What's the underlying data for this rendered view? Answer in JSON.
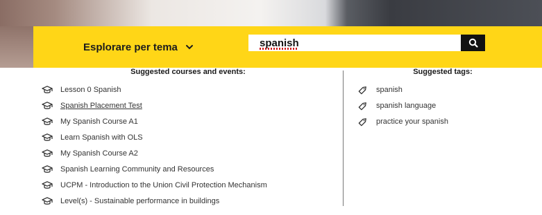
{
  "header": {
    "explore_label": "Esplorare per tema"
  },
  "search": {
    "value": "spanish"
  },
  "suggestions": {
    "courses_title": "Suggested courses and events:",
    "courses": [
      {
        "label": "Lesson 0 Spanish"
      },
      {
        "label": "Spanish Placement Test"
      },
      {
        "label": "My Spanish Course A1"
      },
      {
        "label": "Learn Spanish with OLS"
      },
      {
        "label": "My Spanish Course A2"
      },
      {
        "label": "Spanish Learning Community and Resources"
      },
      {
        "label": "UCPM - Introduction to the Union Civil Protection Mechanism"
      },
      {
        "label": "Level(s) - Sustainable performance in buildings"
      }
    ],
    "tags_title": "Suggested tags:",
    "tags": [
      {
        "label": "spanish"
      },
      {
        "label": "spanish language"
      },
      {
        "label": "practice your spanish"
      }
    ]
  },
  "colors": {
    "accent": "#ffd617",
    "search_button": "#111111"
  },
  "icons": {
    "course": "graduation-cap-icon",
    "tag": "tag-icon",
    "search": "search-icon",
    "dropdown": "chevron-down-icon"
  }
}
